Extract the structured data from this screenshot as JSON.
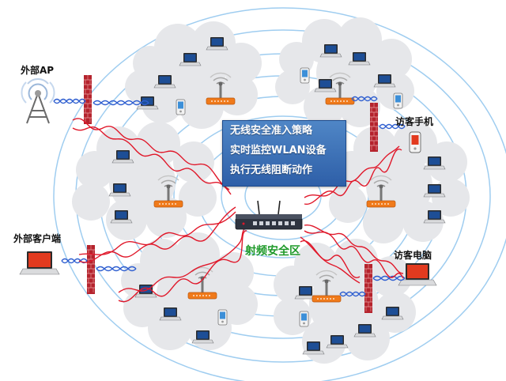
{
  "labels": {
    "external_ap": "外部AP",
    "external_client": "外部客户端",
    "visitor_phone": "访客手机",
    "visitor_pc": "访客电脑",
    "rf_zone": "射频安全区"
  },
  "panel": {
    "line1": "无线安全准入策略",
    "line2": "实时监控WLAN设备",
    "line3": "执行无线阻断动作"
  },
  "colors": {
    "ring": "#9fcdf0",
    "cloud": "#e6e7ea",
    "ap_orange": "#f07a1a",
    "laptop_screen": "#1d4e96",
    "firewall_red": "#b5232d",
    "attack_wave": "#e0182a",
    "normal_wave": "#2f5fd0",
    "zone_text": "#1f9a2a",
    "panel_blue": "#3a6db5"
  },
  "icons": [
    "radio-tower-icon",
    "firewall-icon",
    "laptop-icon",
    "phone-icon",
    "access-point-icon",
    "wips-appliance-icon"
  ]
}
